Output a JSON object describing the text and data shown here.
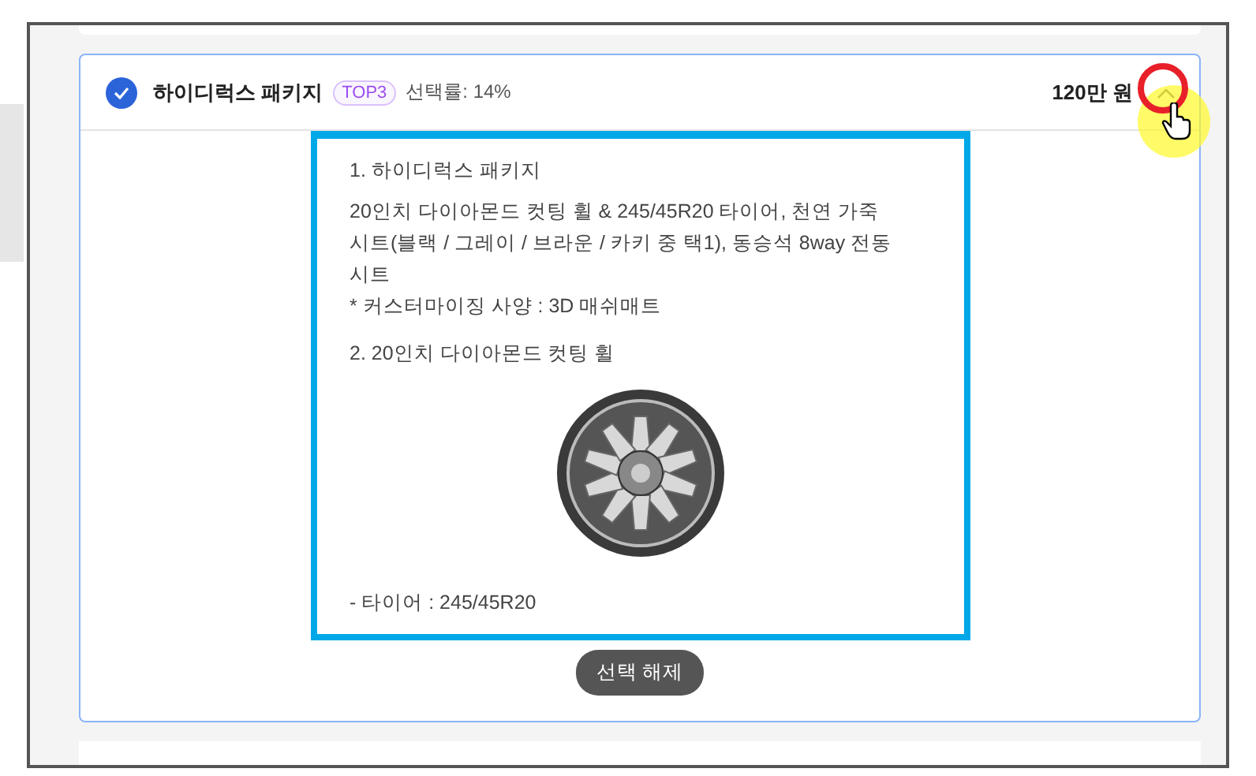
{
  "option": {
    "title": "하이디럭스 패키지",
    "badge": "TOP3",
    "rate": "선택률: 14%",
    "price": "120만 원",
    "selected": true,
    "expanded": true,
    "details": [
      {
        "kind": "heading",
        "text": "1. 하이디럭스 패키지"
      },
      {
        "kind": "paragraph",
        "text": "20인치 다이아몬드 컷팅 휠 & 245/45R20 타이어, 천연 가죽시트(블랙 / 그레이 / 브라운 / 카키 중 택1), 동승석 8way 전동시트"
      },
      {
        "kind": "note",
        "text": "* 커스터마이징 사양 : 3D 매쉬매트"
      },
      {
        "kind": "heading",
        "text": "2. 20인치 다이아몬드 컷팅 휠"
      },
      {
        "kind": "image"
      },
      {
        "kind": "spec",
        "text": "- 타이어 : 245/45R20"
      }
    ],
    "deselect_button": "선택 해제"
  }
}
